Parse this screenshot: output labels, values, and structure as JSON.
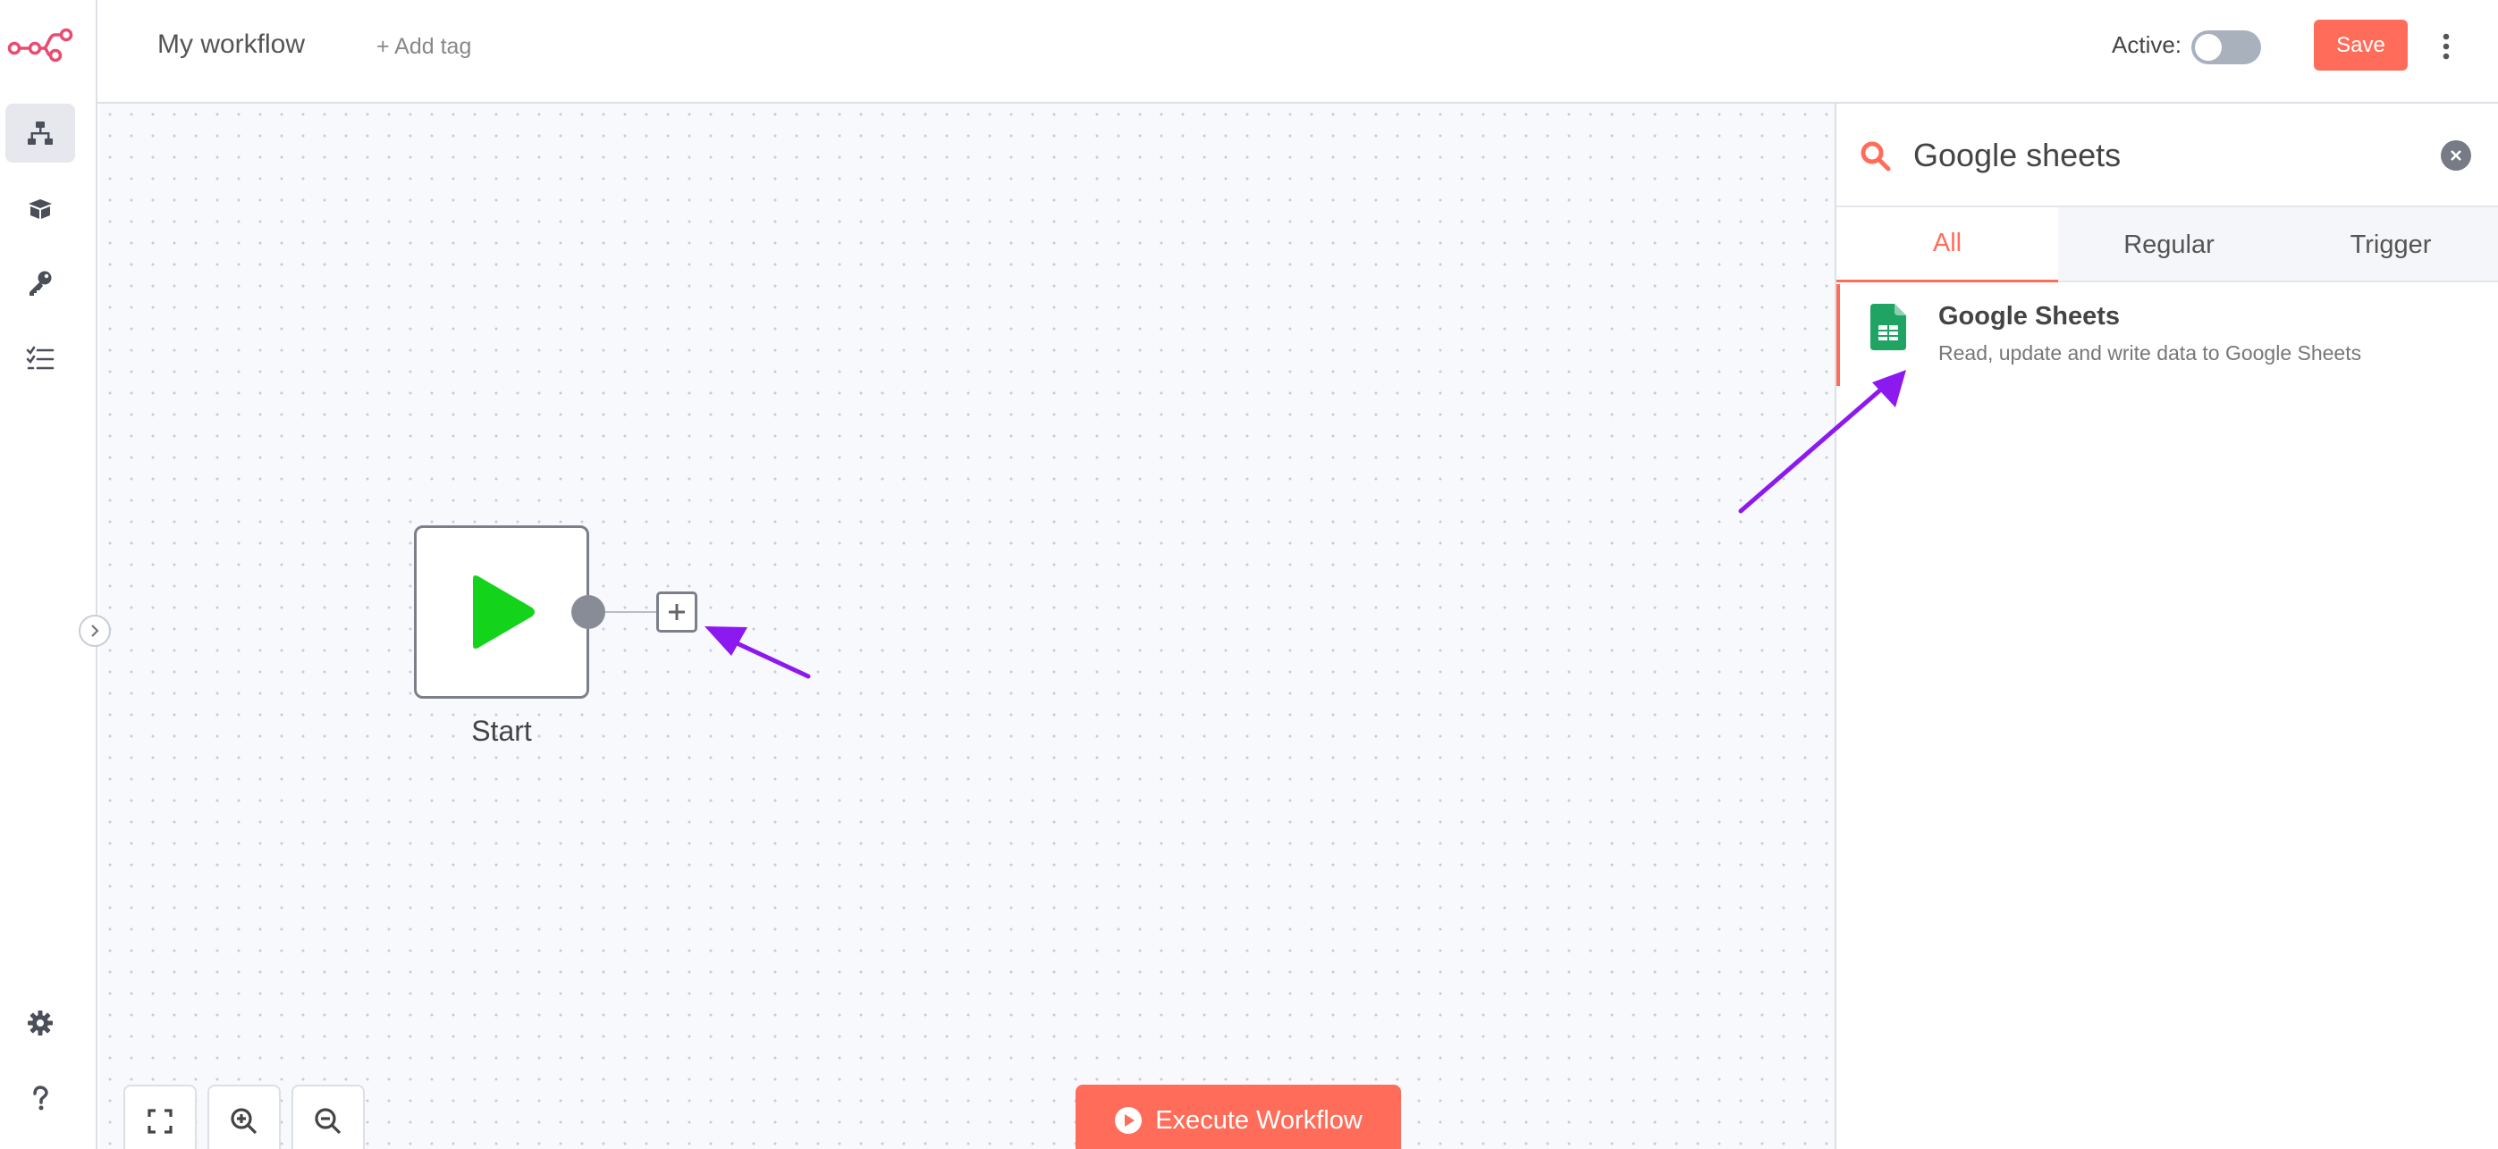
{
  "header": {
    "workflow_name": "My workflow",
    "add_tag_label": "+ Add tag",
    "active_label": "Active:",
    "active": false,
    "save_label": "Save"
  },
  "sidebar": {
    "items": [
      {
        "icon": "workflows-icon",
        "active": true
      },
      {
        "icon": "templates-icon",
        "active": false
      },
      {
        "icon": "credentials-icon",
        "active": false
      },
      {
        "icon": "executions-icon",
        "active": false
      },
      {
        "icon": "settings-icon",
        "active": false
      },
      {
        "icon": "help-icon",
        "active": false
      }
    ]
  },
  "canvas": {
    "start_node_label": "Start",
    "execute_label": "Execute Workflow"
  },
  "node_creator": {
    "search_value": "Google sheets",
    "tabs": [
      {
        "label": "All",
        "active": true
      },
      {
        "label": "Regular",
        "active": false
      },
      {
        "label": "Trigger",
        "active": false
      }
    ],
    "results": [
      {
        "title": "Google Sheets",
        "description": "Read, update and write data to Google Sheets",
        "icon": "google-sheets-icon"
      }
    ]
  },
  "colors": {
    "accent": "#ff6d5a",
    "start_play": "#13d41b",
    "sheets_green": "#20a464",
    "annotation_arrow": "#8c19f0",
    "logo": "#ea4b71"
  }
}
